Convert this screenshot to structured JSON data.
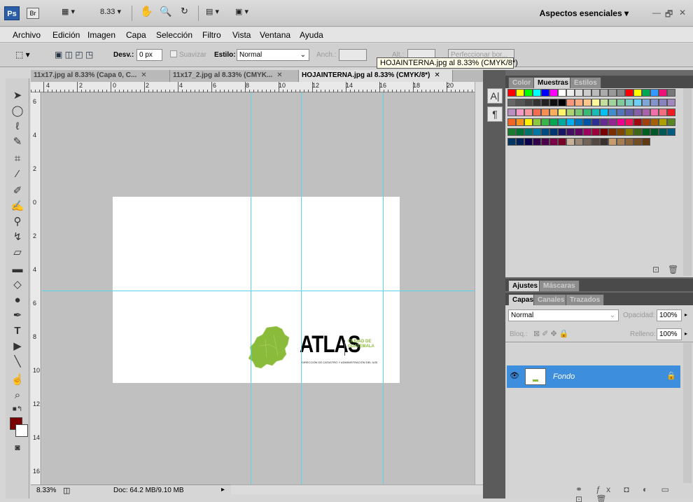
{
  "titlebar": {
    "app_logo": "Ps",
    "bridge_logo": "Br",
    "zoom_value": "8.33 ▾",
    "workspace_label": "Aspectos esenciales ▾",
    "window_controls": [
      "—",
      "🗗",
      "✕"
    ]
  },
  "menu": {
    "items": [
      "Archivo",
      "Edición",
      "Imagen",
      "Capa",
      "Selección",
      "Filtro",
      "Vista",
      "Ventana",
      "Ayuda"
    ]
  },
  "options": {
    "desv_label": "Desv.:",
    "desv_value": "0 px",
    "suavizar_label": "Suavizar",
    "estilo_label": "Estilo:",
    "estilo_value": "Normal",
    "anch_label": "Anch.:",
    "alt_label": "Alt.:",
    "refine_label": "Perfeccionar bor..."
  },
  "tooltip": "HOJAINTERNA.jpg al 8.33% (CMYK/8*)",
  "tabs": [
    {
      "label": "11x17.jpg al 8.33% (Capa 0, C...",
      "close": "✕"
    },
    {
      "label": "11x17_2.jpg al 8.33% (CMYK...",
      "close": "✕"
    },
    {
      "label": "HOJAINTERNA.jpg al 8.33% (CMYK/8*)",
      "close": "✕"
    }
  ],
  "ruler_h": [
    "4",
    "2",
    "0",
    "2",
    "4",
    "6",
    "8",
    "10",
    "12",
    "14",
    "16",
    "18",
    "20"
  ],
  "ruler_v": [
    "6",
    "4",
    "2",
    "0",
    "2",
    "4",
    "6",
    "8",
    "10",
    "12",
    "14",
    "16"
  ],
  "document": {
    "logo_text": "ATLAS",
    "logo_sub_1": "CIUDAD DE",
    "logo_sub_2": "GUATEMALA",
    "logo_tagline": "DIRECCIÓN DE CATASTRO Y ADMINISTRACIÓN DEL IUSI"
  },
  "status": {
    "zoom": "8.33%",
    "doc_info": "Doc: 64.2 MB/9.10 MB"
  },
  "swatch_panel": {
    "tabs": [
      "Color",
      "Muestras",
      "Estilos"
    ],
    "colors": [
      "#ff0000",
      "#ffff00",
      "#00ff00",
      "#00ffff",
      "#0000ff",
      "#ff00ff",
      "#ffffff",
      "#eeeeee",
      "#dddddd",
      "#cccccc",
      "#bbbbbb",
      "#aaaaaa",
      "#999999",
      "#888888",
      "#ff0000",
      "#ffff00",
      "#00a650",
      "#3399ff",
      "#ee1177",
      "#777777",
      "#666666",
      "#555555",
      "#444444",
      "#333333",
      "#222222",
      "#111111",
      "#000000",
      "#f7977a",
      "#f9ad81",
      "#fdc68a",
      "#fff79a",
      "#c4df9b",
      "#a2d39c",
      "#82ca9d",
      "#7bcdc8",
      "#6ecff6",
      "#7ea7d8",
      "#8493ca",
      "#8882be",
      "#a187be",
      "#bc8dbf",
      "#f49ac2",
      "#f6989d",
      "#f26c4f",
      "#f68e55",
      "#fbaf5c",
      "#fff467",
      "#acd372",
      "#7cc576",
      "#3bb878",
      "#1abbb4",
      "#00bff3",
      "#438cca",
      "#5574b9",
      "#605ca8",
      "#855fa8",
      "#a763a8",
      "#f06ea9",
      "#f26d7d",
      "#ed1c24",
      "#f26522",
      "#f7941d",
      "#fff200",
      "#8dc63f",
      "#39b54a",
      "#00a651",
      "#00a99d",
      "#00aeef",
      "#0072bc",
      "#0054a6",
      "#2e3192",
      "#662d91",
      "#92278f",
      "#ec008c",
      "#ed145b",
      "#9e0b0f",
      "#a0410d",
      "#a3620a",
      "#aba000",
      "#598527",
      "#197b30",
      "#007236",
      "#00746b",
      "#0076a3",
      "#004b80",
      "#003471",
      "#1b1464",
      "#440e62",
      "#630460",
      "#9e005d",
      "#9e0039",
      "#790000",
      "#7b2e00",
      "#7d4900",
      "#827b00",
      "#406618",
      "#005e20",
      "#005826",
      "#005952",
      "#005b7f",
      "#003663",
      "#002157",
      "#0d004c",
      "#32004b",
      "#4b0049",
      "#7b0046",
      "#7a0026",
      "#c7b299",
      "#998675",
      "#736357",
      "#534741",
      "#37302d",
      "#c69c6d",
      "#a67c52",
      "#8c6239",
      "#754c24",
      "#603913"
    ]
  },
  "adjust_panel": {
    "tabs": [
      "Ajustes",
      "Máscaras"
    ]
  },
  "layers_panel": {
    "tabs": [
      "Capas",
      "Canales",
      "Trazados"
    ],
    "blend_mode": "Normal",
    "opacity_label": "Opacidad:",
    "opacity_value": "100%",
    "lock_label": "Bloq.:",
    "fill_label": "Relleno:",
    "fill_value": "100%",
    "layer_name": "Fondo"
  },
  "colors": {
    "fg_color": "#7a0000",
    "bg_color": "#ffffff",
    "layer_selected": "#3e8ede",
    "guide": "#59d4e8",
    "logo_green": "#8bbb3a"
  }
}
